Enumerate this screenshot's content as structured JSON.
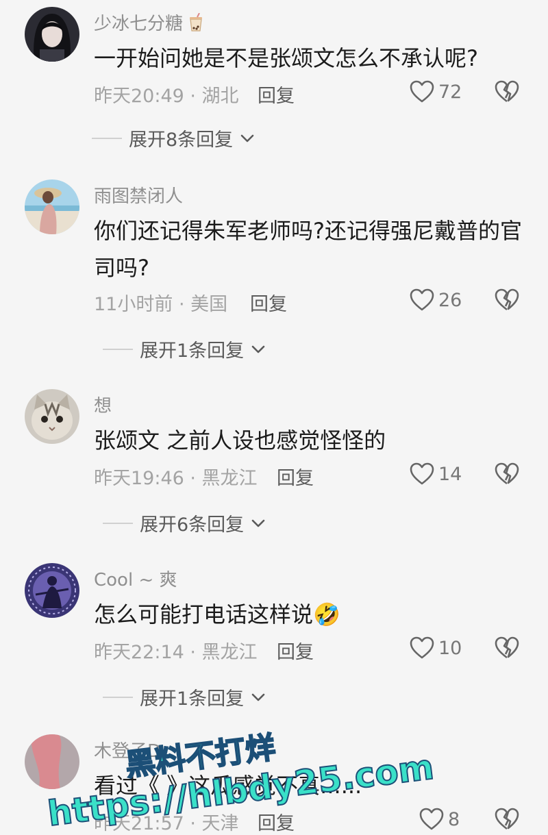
{
  "comments": [
    {
      "username": "少冰七分糖",
      "username_icon": "bubble-tea-icon",
      "text": "一开始问她是不是张颂文怎么不承认呢?",
      "time_location": "昨天20:49 · 湖北",
      "reply_label": "回复",
      "likes": "72",
      "expand_label": "展开8条回复"
    },
    {
      "username": "雨图禁闭人",
      "text": "你们还记得朱军老师吗?还记得强尼戴普的官司吗?",
      "time_location": "11小时前 · 美国",
      "reply_label": "回复",
      "likes": "26",
      "expand_label": "展开1条回复"
    },
    {
      "username": "想",
      "text": "张颂文 之前人设也感觉怪怪的",
      "time_location": "昨天19:46 · 黑龙江",
      "reply_label": "回复",
      "likes": "14",
      "expand_label": "展开6条回复"
    },
    {
      "username": "Cool ~ 爽",
      "text": "怎么可能打电话这样说",
      "text_emoji": "🤣",
      "time_location": "昨天22:14 · 黑龙江",
      "reply_label": "回复",
      "likes": "10",
      "expand_label": "展开1条回复"
    },
    {
      "username": "木登子D",
      "text": "看过《 》这瓜感觉不真......",
      "time_location": "昨天21:57 · 天津",
      "reply_label": "回复",
      "likes": "8"
    }
  ],
  "watermark": {
    "line1": "黑料不打烊",
    "line2": "https://hlbdy25.com"
  },
  "colors": {
    "background": "#f5f5f5",
    "meta_text": "#a3a3a3",
    "watermark_fill": "#3ae0c8",
    "watermark_stroke": "#1c4f77"
  }
}
